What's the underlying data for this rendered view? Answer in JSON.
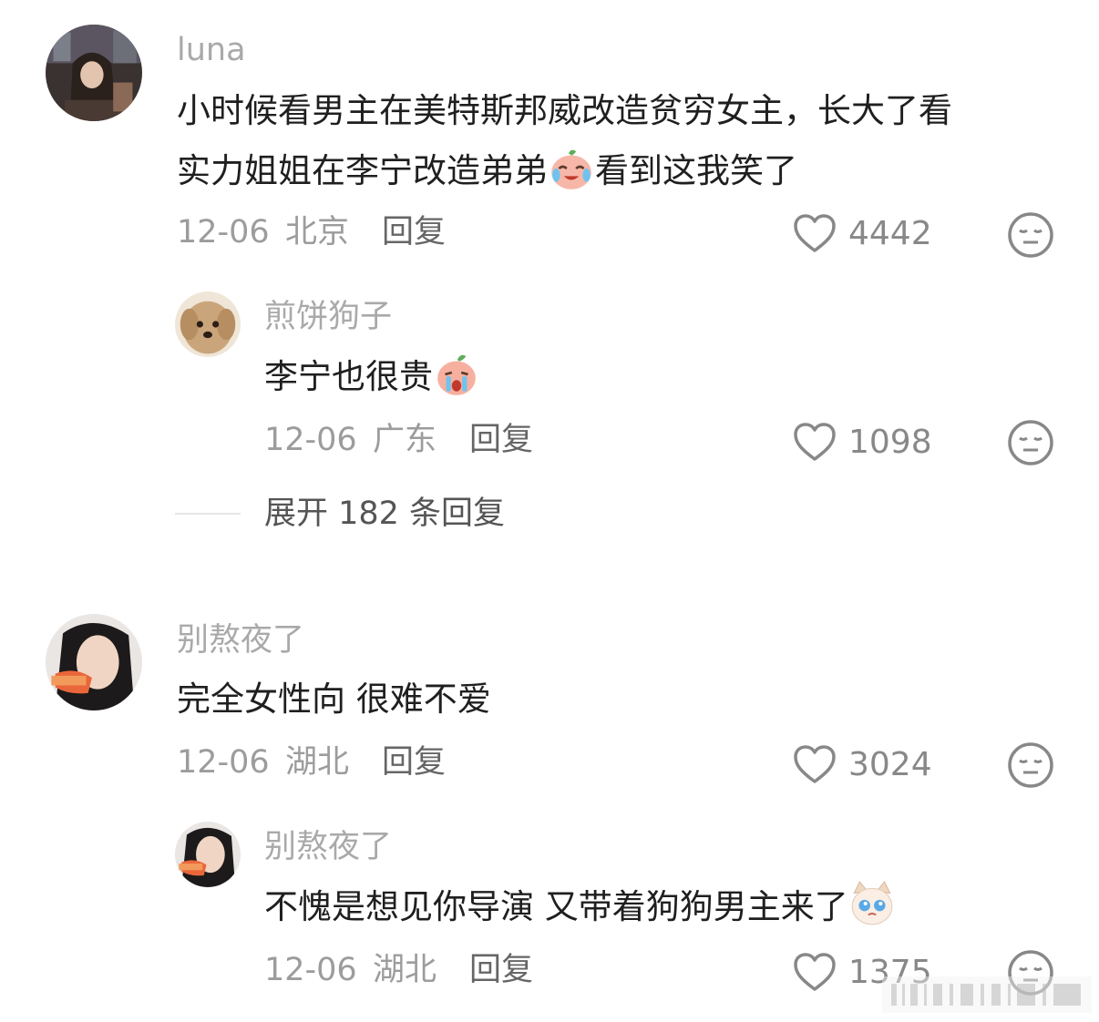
{
  "comments": [
    {
      "username": "luna",
      "text_line1": "小时候看男主在美特斯邦威改造贫穷女主，长大了看",
      "text_line2_before": "实力姐姐在李宁改造弟弟",
      "text_line2_after": "看到这我笑了",
      "date": "12-06",
      "location": "北京",
      "reply_label": "回复",
      "likes": "4442",
      "emoji": "crying-laughing-peach-emoji",
      "replies": [
        {
          "username": "煎饼狗子",
          "text_before": "李宁也很贵",
          "date": "12-06",
          "location": "广东",
          "reply_label": "回复",
          "likes": "1098",
          "emoji": "crying-peach-emoji"
        }
      ],
      "expand_label": "展开 182 条回复"
    },
    {
      "username": "别熬夜了",
      "text_line1": "完全女性向 很难不爱",
      "date": "12-06",
      "location": "湖北",
      "reply_label": "回复",
      "likes": "3024",
      "replies": [
        {
          "username": "别熬夜了",
          "text_before": "不愧是想见你导演 又带着狗狗男主来了",
          "date": "12-06",
          "location": "湖北",
          "reply_label": "回复",
          "likes": "1375",
          "emoji": "teary-cat-emoji"
        }
      ]
    }
  ],
  "icons": {
    "like": "heart-outline-icon",
    "dislike": "meh-face-icon"
  },
  "colors": {
    "username": "#a9a9a9",
    "text": "#1f1f1f",
    "meta": "#9c9c9c"
  }
}
